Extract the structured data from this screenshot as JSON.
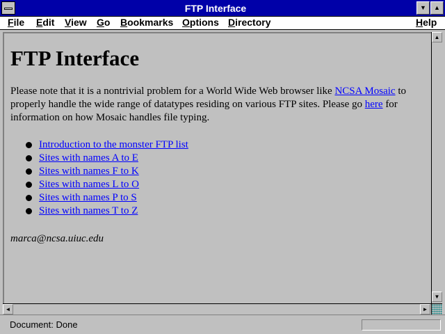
{
  "window": {
    "title": "FTP Interface",
    "minimize_glyph": "▼",
    "maximize_glyph": "▲"
  },
  "menu": {
    "items": [
      {
        "label": "File"
      },
      {
        "label": "Edit"
      },
      {
        "label": "View"
      },
      {
        "label": "Go"
      },
      {
        "label": "Bookmarks"
      },
      {
        "label": "Options"
      },
      {
        "label": "Directory"
      },
      {
        "label": "Help"
      }
    ]
  },
  "page": {
    "heading": "FTP Interface",
    "para_part1": "Please note that it is a nontrivial problem for a World Wide Web browser like ",
    "link_mosaic": "NCSA Mosaic",
    "para_part2": " to properly handle the wide range of datatypes residing on various FTP sites. Please go ",
    "link_here": "here",
    "para_part3": " for information on how Mosaic handles file typing.",
    "links": [
      "Introduction to the monster FTP list",
      "Sites with names A to E",
      "Sites with names F to K",
      "Sites with names L to O",
      "Sites with names P to S",
      "Sites with names T to Z"
    ],
    "signature": "marca@ncsa.uiuc.edu"
  },
  "scrollbars": {
    "up_glyph": "▲",
    "down_glyph": "▼",
    "left_glyph": "◄",
    "right_glyph": "►"
  },
  "status": {
    "text": "Document: Done"
  },
  "colors": {
    "titlebar": "#0000a8",
    "link": "#0000ff",
    "window_bg": "#c0c0c0"
  }
}
